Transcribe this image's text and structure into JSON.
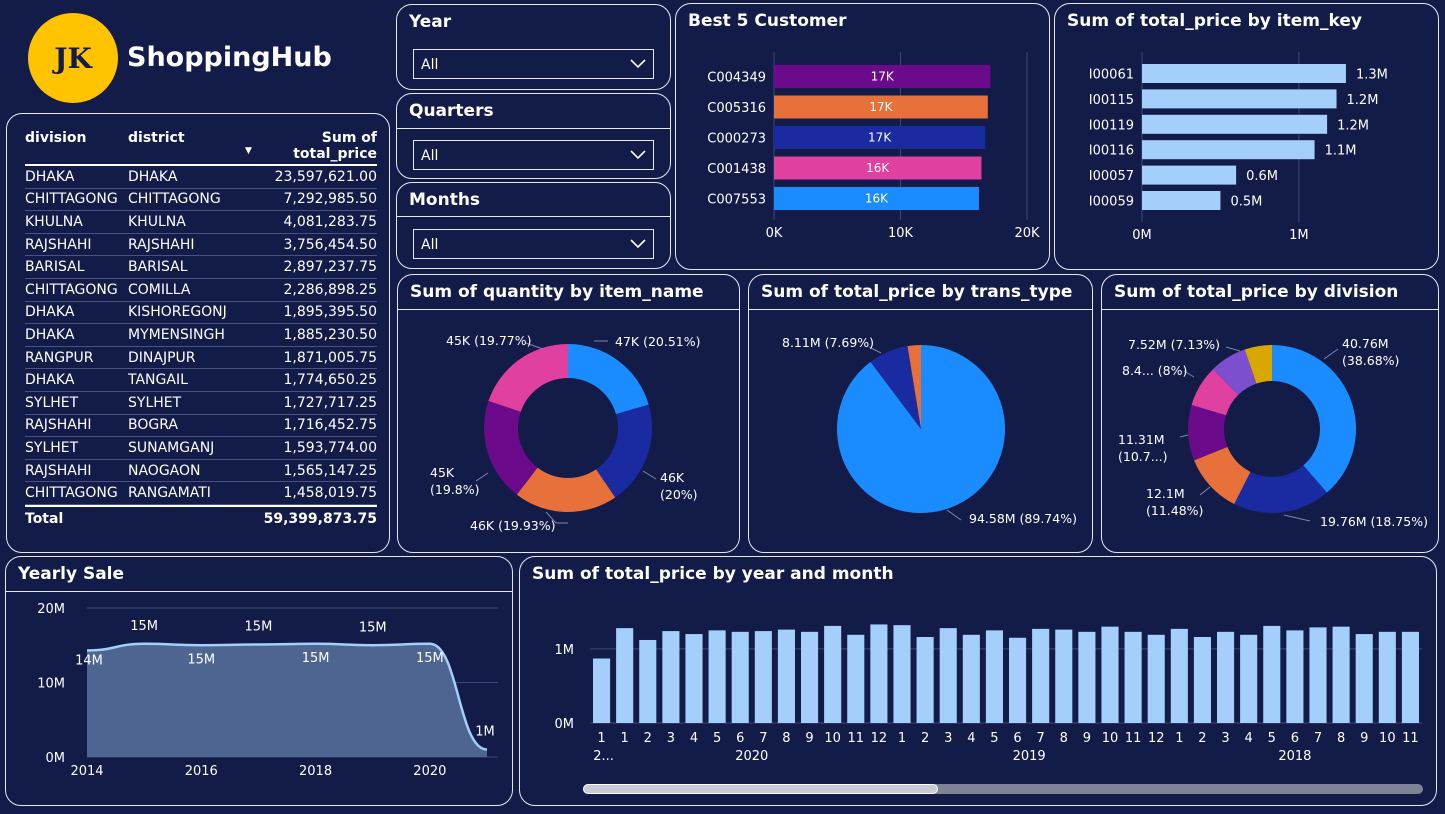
{
  "logo": {
    "initials": "JK",
    "brand": "ShoppingHub",
    "color": "#ffc300"
  },
  "slicers": [
    {
      "title": "Year",
      "value": "All"
    },
    {
      "title": "Quarters",
      "value": "All"
    },
    {
      "title": "Months",
      "value": "All"
    }
  ],
  "table": {
    "headers": [
      "division",
      "district",
      "Sum of total_price"
    ],
    "rows": [
      [
        "DHAKA",
        "DHAKA",
        "23,597,621.00"
      ],
      [
        "CHITTAGONG",
        "CHITTAGONG",
        "7,292,985.50"
      ],
      [
        "KHULNA",
        "KHULNA",
        "4,081,283.75"
      ],
      [
        "RAJSHAHI",
        "RAJSHAHI",
        "3,756,454.50"
      ],
      [
        "BARISAL",
        "BARISAL",
        "2,897,237.75"
      ],
      [
        "CHITTAGONG",
        "COMILLA",
        "2,286,898.25"
      ],
      [
        "DHAKA",
        "KISHOREGONJ",
        "1,895,395.50"
      ],
      [
        "DHAKA",
        "MYMENSINGH",
        "1,885,230.50"
      ],
      [
        "RANGPUR",
        "DINAJPUR",
        "1,871,005.75"
      ],
      [
        "DHAKA",
        "TANGAIL",
        "1,774,650.25"
      ],
      [
        "SYLHET",
        "SYLHET",
        "1,727,717.25"
      ],
      [
        "RAJSHAHI",
        "BOGRA",
        "1,716,452.75"
      ],
      [
        "SYLHET",
        "SUNAMGANJ",
        "1,593,774.00"
      ],
      [
        "RAJSHAHI",
        "NAOGAON",
        "1,565,147.25"
      ],
      [
        "CHITTAGONG",
        "RANGAMATI",
        "1,458,019.75"
      ]
    ],
    "total_label": "Total",
    "total_value": "59,399,873.75"
  },
  "chart_data": [
    {
      "id": "best5",
      "type": "bar",
      "orientation": "horizontal",
      "title": "Best 5 Customer",
      "categories": [
        "C004349",
        "C005316",
        "C000273",
        "C001438",
        "C007553"
      ],
      "values": [
        17100,
        16900,
        16700,
        16400,
        16200
      ],
      "data_labels": [
        "17K",
        "17K",
        "17K",
        "16K",
        "16K"
      ],
      "colors": [
        "#6b0a8a",
        "#e8703a",
        "#1a2aa0",
        "#e040a0",
        "#1a8cff"
      ],
      "xlim": [
        0,
        20000
      ],
      "xticks": [
        "0K",
        "10K",
        "20K"
      ]
    },
    {
      "id": "itemkey",
      "type": "bar",
      "orientation": "horizontal",
      "title": "Sum of total_price by item_key",
      "categories": [
        "I00061",
        "I00115",
        "I00119",
        "I00116",
        "I00057",
        "I00059"
      ],
      "values": [
        1.3,
        1.24,
        1.18,
        1.1,
        0.6,
        0.5
      ],
      "data_labels": [
        "1.3M",
        "1.2M",
        "1.2M",
        "1.1M",
        "0.6M",
        "0.5M"
      ],
      "color": "#a3cffa",
      "xlim": [
        0,
        1.6
      ],
      "xticks": [
        "0M",
        "1M"
      ]
    },
    {
      "id": "qty",
      "type": "pie",
      "donut": true,
      "title": "Sum of quantity by item_name",
      "values": [
        20.51,
        20,
        19.93,
        19.8,
        19.77
      ],
      "labels": [
        "47K (20.51%)",
        "46K (20%)",
        "46K (19.93%)",
        "45K (19.8%)",
        "45K (19.77%)"
      ],
      "colors": [
        "#1a8cff",
        "#1a2aa0",
        "#e8703a",
        "#6b0a8a",
        "#e040a0"
      ]
    },
    {
      "id": "trans",
      "type": "pie",
      "donut": false,
      "title": "Sum of total_price by trans_type",
      "values": [
        89.74,
        7.69,
        2.57
      ],
      "labels": [
        "94.58M (89.74%)",
        "8.11M (7.69%)",
        ""
      ],
      "colors": [
        "#1a8cff",
        "#1a2aa0",
        "#e8703a"
      ]
    },
    {
      "id": "division",
      "type": "pie",
      "donut": true,
      "title": "Sum of total_price by division",
      "values": [
        38.68,
        18.75,
        11.48,
        10.7,
        8,
        7.13,
        5.26
      ],
      "labels": [
        "40.76M (38.68%)",
        "19.76M (18.75%)",
        "12.1M (11.48%)",
        "11.31M (10.7...)",
        "8.4... (8%)",
        "7.52M (7.13%)",
        ""
      ],
      "colors": [
        "#1a8cff",
        "#1a2aa0",
        "#e8703a",
        "#6b0a8a",
        "#e040a0",
        "#7b4fd0",
        "#d9a800"
      ]
    },
    {
      "id": "yearly",
      "type": "area",
      "title": "Yearly Sale",
      "x": [
        2014,
        2015,
        2016,
        2017,
        2018,
        2019,
        2020,
        2021
      ],
      "values": [
        14.3,
        15.2,
        15.0,
        15.1,
        15.2,
        15.0,
        15.2,
        1.0
      ],
      "data_labels": [
        "14M",
        "15M",
        "15M",
        "15M",
        "15M",
        "15M",
        "15M",
        "1M"
      ],
      "ylim": [
        0,
        20
      ],
      "yticks": [
        "0M",
        "10M",
        "20M"
      ],
      "xticks": [
        2014,
        2016,
        2018,
        2020
      ],
      "color": "#a3cffa"
    },
    {
      "id": "monthly",
      "type": "bar",
      "title": "Sum of total_price by year and month",
      "categories": [
        "1",
        "1",
        "2",
        "3",
        "4",
        "5",
        "6",
        "7",
        "8",
        "9",
        "10",
        "11",
        "12",
        "1",
        "2",
        "3",
        "4",
        "5",
        "6",
        "7",
        "8",
        "9",
        "10",
        "11",
        "12",
        "1",
        "2",
        "3",
        "4",
        "5",
        "6",
        "7",
        "8",
        "9",
        "10",
        "11"
      ],
      "values": [
        0.87,
        1.28,
        1.12,
        1.24,
        1.2,
        1.25,
        1.23,
        1.24,
        1.26,
        1.23,
        1.31,
        1.19,
        1.33,
        1.32,
        1.16,
        1.28,
        1.19,
        1.25,
        1.15,
        1.27,
        1.26,
        1.23,
        1.3,
        1.23,
        1.19,
        1.27,
        1.16,
        1.23,
        1.19,
        1.31,
        1.25,
        1.29,
        1.3,
        1.2,
        1.23,
        1.23
      ],
      "groups": [
        {
          "label": "2...",
          "start": 0,
          "end": 0
        },
        {
          "label": "2020",
          "start": 1,
          "end": 12
        },
        {
          "label": "2019",
          "start": 13,
          "end": 24
        },
        {
          "label": "2018",
          "start": 25,
          "end": 35
        }
      ],
      "ylim": [
        0,
        1.7
      ],
      "yticks": [
        "0M",
        "1M"
      ],
      "color": "#a3cffa"
    }
  ]
}
